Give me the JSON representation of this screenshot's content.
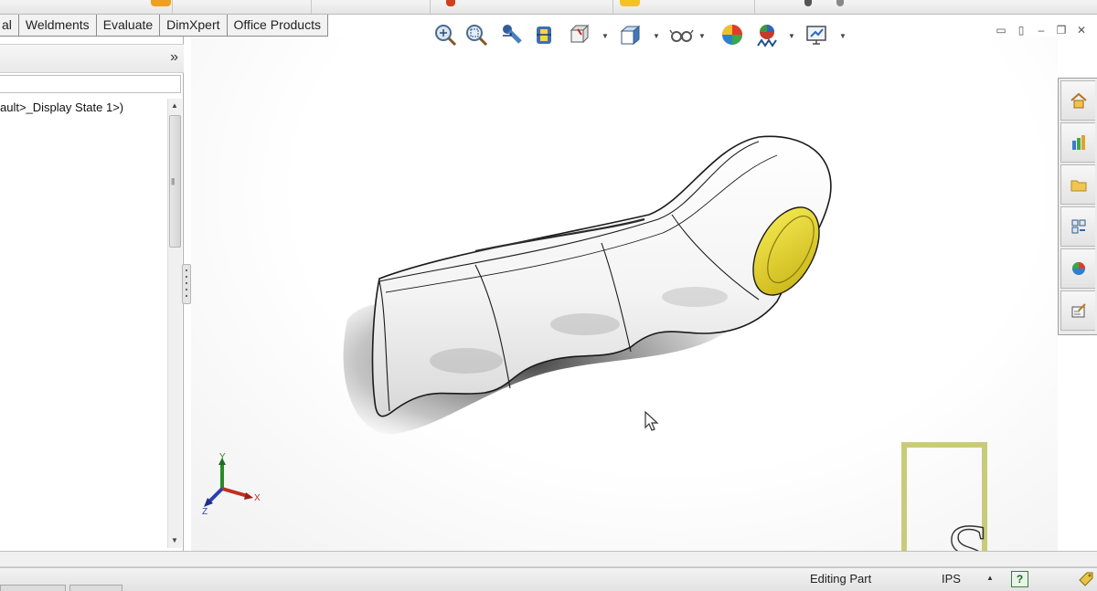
{
  "command_tabs": [
    "al",
    "Weldments",
    "Evaluate",
    "DimXpert",
    "Office Products"
  ],
  "feature_tree": {
    "expand_glyph": "»",
    "item_label": "ault>_Display State 1>)"
  },
  "view_toolbar": {
    "buttons": [
      {
        "icon": "zoom-to-fit-icon"
      },
      {
        "icon": "zoom-to-area-icon"
      },
      {
        "icon": "previous-view-icon"
      },
      {
        "icon": "section-view-icon"
      },
      {
        "icon": "dynamic-annotation-views-icon",
        "has_menu": true
      },
      {
        "icon": "view-orientation-icon",
        "has_menu": true
      },
      {
        "icon": "hide-show-items-icon",
        "has_menu": true
      },
      {
        "icon": "edit-appearance-icon"
      },
      {
        "icon": "apply-scene-icon",
        "has_menu": true
      },
      {
        "icon": "view-settings-icon",
        "has_menu": true
      }
    ]
  },
  "task_pane": [
    "home-icon",
    "design-library-icon",
    "file-explorer-icon",
    "view-palette-icon",
    "appearances-icon",
    "custom-properties-icon"
  ],
  "triad": {
    "x_label": "X",
    "y_label": "Y",
    "z_label": "Z"
  },
  "watermark": {
    "letter": "S"
  },
  "colors": {
    "accent_yellow": "#e3d23a",
    "watermark_green": "#c8cc7a"
  },
  "status_bar": {
    "mode": "Editing Part",
    "units": "IPS",
    "help": "?"
  }
}
